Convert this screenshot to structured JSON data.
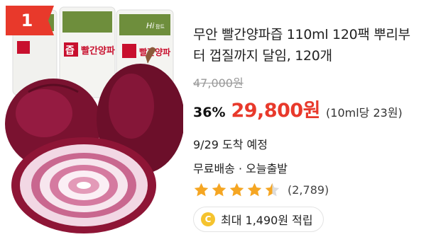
{
  "product": {
    "rank": "1",
    "image": {
      "pouch_label": "즙",
      "pouch_name": "빨간양파",
      "brand_mark": "Hi",
      "brand_suffix": "팜트"
    },
    "title": "무안 빨간양파즙 110ml 120팩 뿌리부터 껍질까지 달임, 120개",
    "original_price": "47,000원",
    "discount": "36%",
    "price": "29,800원",
    "unit_price": "(10ml당 23원)",
    "delivery_date": "9/29 도착 예정",
    "shipping": "무료배송 · 오늘출발",
    "rating": 4.5,
    "review_count": "(2,789)",
    "points_icon": "C",
    "points": "최대 1,490원 적립"
  },
  "colors": {
    "accent": "#e8392b",
    "star": "#f5a623"
  }
}
